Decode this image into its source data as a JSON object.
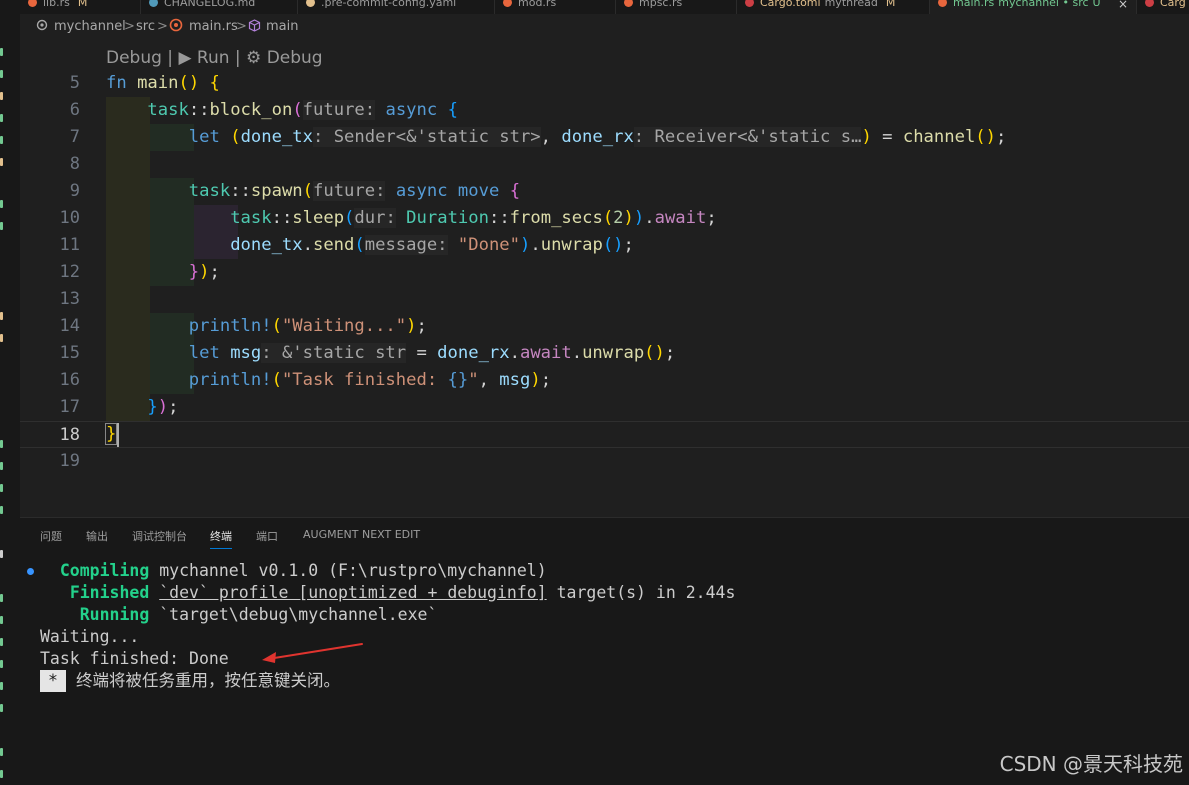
{
  "colors": {
    "accent": "#0078d4",
    "terminal_green": "#23d18b",
    "arrow_red": "#e0342f",
    "modified_tab": "#73c991"
  },
  "tabs": [
    {
      "label": "lib.rs",
      "status": "M",
      "icon": "rust-file-icon"
    },
    {
      "label": "CHANGELOG.md",
      "status": "",
      "icon": "markdown-file-icon"
    },
    {
      "label": ".pre-commit-config.yaml",
      "status": "",
      "icon": "yaml-file-icon"
    },
    {
      "label": "mod.rs",
      "status": "",
      "icon": "rust-file-icon"
    },
    {
      "label": "mpsc.rs",
      "status": "",
      "icon": "rust-file-icon"
    },
    {
      "label": "Cargo.toml",
      "sub": "mythread",
      "status": "M",
      "icon": "toml-file-icon"
    },
    {
      "label": "main.rs",
      "sub": "mychannel • src",
      "status": "U",
      "icon": "rust-file-icon",
      "active": true
    },
    {
      "label": "Carg",
      "status": "",
      "icon": "toml-file-icon"
    }
  ],
  "breadcrumbs": {
    "items": [
      "mychannel",
      "src",
      "main.rs",
      "main"
    ],
    "separator": ">"
  },
  "codelens": "Debug | ▶ Run | ⚙ Debug",
  "line_numbers": [
    "5",
    "6",
    "7",
    "8",
    "9",
    "10",
    "11",
    "12",
    "13",
    "14",
    "15",
    "16",
    "17",
    "18",
    "19"
  ],
  "current_line": "18",
  "panel": {
    "tabs": [
      "问题",
      "输出",
      "调试控制台",
      "终端",
      "端口",
      "AUGMENT NEXT EDIT"
    ],
    "active_tab": "终端"
  },
  "terminal": {
    "compiling_label": "Compiling",
    "compiling_text": " mychannel v0.1.0 (F:\\rustpro\\mychannel)",
    "finished_label": "Finished",
    "finished_profile": "`dev` profile [unoptimized + debuginfo]",
    "finished_rest": " target(s) in 2.44s",
    "running_label": "Running",
    "running_text": " `target\\debug\\mychannel.exe`",
    "waiting": "Waiting...",
    "task_finished": "Task finished: Done",
    "reuse_badge": "*",
    "reuse_message": "终端将被任务重用，按任意键关闭。"
  },
  "watermark": "CSDN @景天科技苑"
}
